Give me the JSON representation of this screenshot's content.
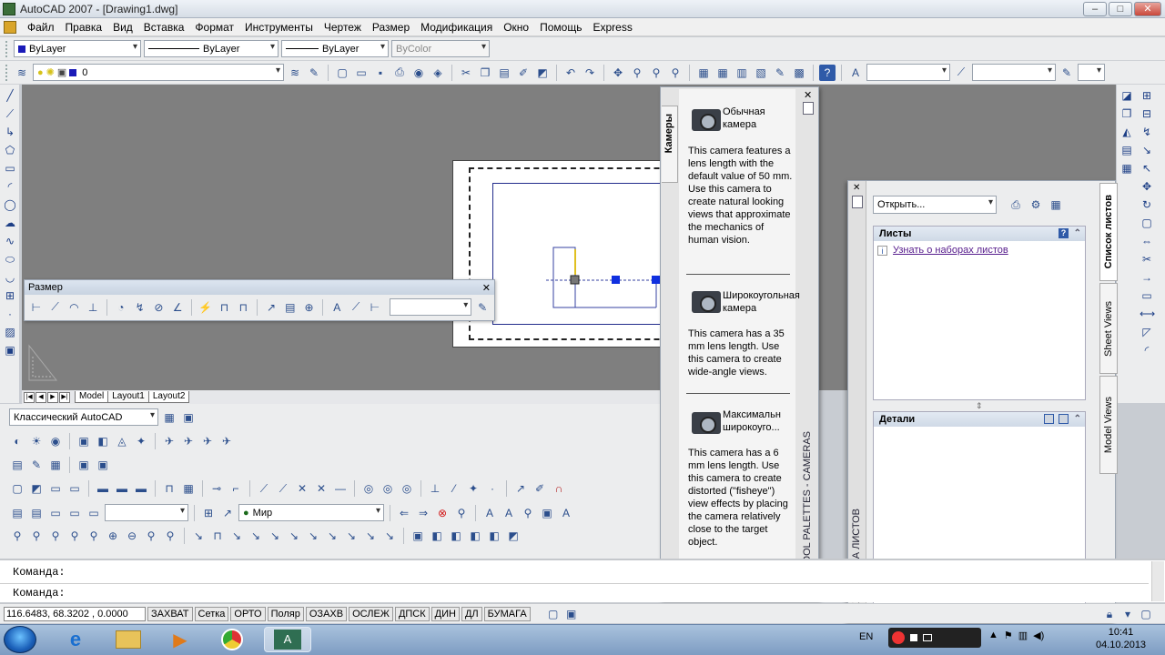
{
  "window": {
    "title": "AutoCAD 2007 - [Drawing1.dwg]",
    "minimize": "–",
    "maximize": "□",
    "close": "✕"
  },
  "menu": [
    "Файл",
    "Правка",
    "Вид",
    "Вставка",
    "Формат",
    "Инструменты",
    "Чертеж",
    "Размер",
    "Модификация",
    "Окно",
    "Помощь",
    "Express"
  ],
  "properties": {
    "color": "ByLayer",
    "linetype": "ByLayer",
    "lineweight": "ByLayer",
    "plotstyle": "ByColor"
  },
  "layer": {
    "current": "0"
  },
  "layout_tabs": [
    "Model",
    "Layout1",
    "Layout2"
  ],
  "dim_toolbar": {
    "title": "Размер",
    "close": "✕"
  },
  "workspace": "Классический AutoCAD",
  "ucs": "Мир",
  "command": {
    "line1": "Команда:",
    "line2": "Команда:"
  },
  "status": {
    "coords": "116.6483, 68.3202 , 0.0000",
    "toggles": [
      "ЗАХВАТ",
      "Сетка",
      "ОРТО",
      "Поляр",
      "ОЗАХВ",
      "ОСЛЕЖ",
      "ДПСК",
      "ДИН",
      "ДЛ",
      "БУМАГА"
    ]
  },
  "palette": {
    "tab": "Камеры",
    "side_title": "TOOL PALETTES - CAMERAS",
    "cameras": [
      {
        "name": "Обычная камера",
        "desc": "This camera features a lens length with the default value of 50 mm.  Use this camera to create natural looking views that approximate the mechanics of human vision."
      },
      {
        "name": "Широкоугольная камера",
        "desc": "This camera has a 35 mm lens length.  Use this camera to create wide-angle views."
      },
      {
        "name": "Максимальн широкоуго...",
        "desc": "This camera has a 6 mm lens length.  Use this camera to create distorted (\"fisheye\") view effects by placing the camera relatively close to the target object."
      }
    ]
  },
  "ssm": {
    "open": "Открыть...",
    "sheets_title": "Листы",
    "sheets_link": "Узнать о наборах листов",
    "details_title": "Детали",
    "side_title": "ЖЕР НАБОРА ЛИСТОВ",
    "tabs": [
      "Список листов",
      "Sheet Views",
      "Model Views"
    ]
  },
  "taskbar": {
    "lang": "EN",
    "time": "10:41",
    "date": "04.10.2013"
  }
}
